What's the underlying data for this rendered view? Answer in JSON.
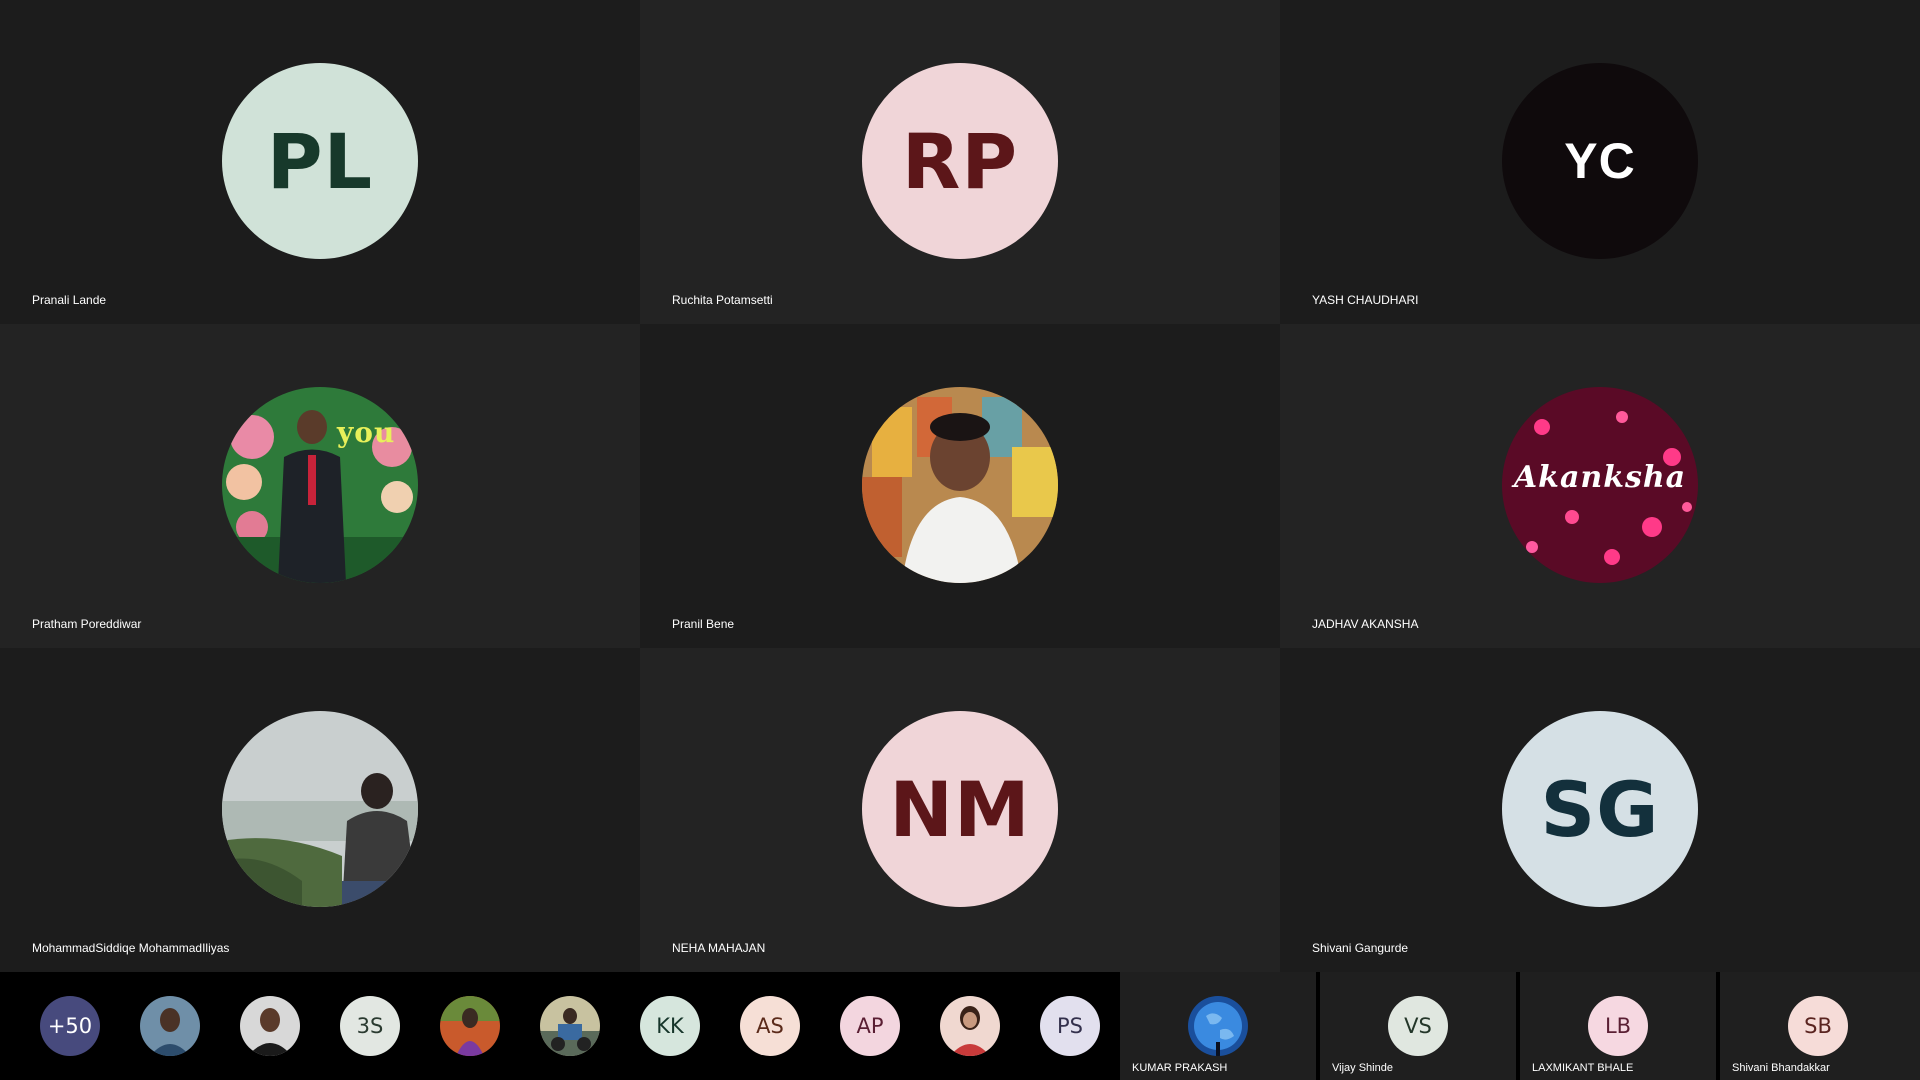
{
  "tiles": [
    {
      "name": "Pranali Lande",
      "initials": "PL",
      "bg": "#d0e2d8",
      "fg": "#17392b"
    },
    {
      "name": "Ruchita Potamsetti",
      "initials": "RP",
      "bg": "#f0d5d8",
      "fg": "#5c1619"
    },
    {
      "name": "YASH CHAUDHARI",
      "initials": "YC",
      "bg": "#0f0a0c",
      "fg": "#ffffff"
    },
    {
      "name": "Pratham Poreddiwar",
      "initials": "",
      "photo": "person-photo"
    },
    {
      "name": "Pranil Bene",
      "initials": "",
      "photo": "person-photo"
    },
    {
      "name": "JADHAV AKANSHA",
      "initials": "",
      "photo": "text-photo",
      "photo_text": "Akanksha"
    },
    {
      "name": "MohammadSiddiqe MohammadIliyas",
      "initials": "",
      "photo": "landscape-photo"
    },
    {
      "name": "NEHA MAHAJAN",
      "initials": "NM",
      "bg": "#f0d5d8",
      "fg": "#5c1619"
    },
    {
      "name": "Shivani Gangurde",
      "initials": "SG",
      "bg": "#d5e0e5",
      "fg": "#13303c"
    }
  ],
  "strip": {
    "overflow_count": "+50",
    "bubbles": [
      {
        "initials": "",
        "photo": true
      },
      {
        "initials": "",
        "photo": true
      },
      {
        "initials": "3S",
        "bg": "#e2e7e2",
        "fg": "#2a3a30"
      },
      {
        "initials": "",
        "photo": true
      },
      {
        "initials": "",
        "photo": true
      },
      {
        "initials": "KK",
        "bg": "#d6e6dd",
        "fg": "#16352a"
      },
      {
        "initials": "AS",
        "bg": "#f6dfd6",
        "fg": "#5b2a1a"
      },
      {
        "initials": "AP",
        "bg": "#f3d6df",
        "fg": "#5a1e33"
      },
      {
        "initials": "",
        "photo": true
      },
      {
        "initials": "PS",
        "bg": "#e2e0ee",
        "fg": "#33304c"
      }
    ],
    "named": [
      {
        "name": "KUMAR PRAKASH",
        "initials": "",
        "photo": true
      },
      {
        "name": "Vijay Shinde",
        "initials": "VS",
        "bg": "#e0e7e0",
        "fg": "#233629"
      },
      {
        "name": "LAXMIKANT BHALE",
        "initials": "LB",
        "bg": "#f6d8e1",
        "fg": "#5a1f33"
      },
      {
        "name": "Shivani Bhandakkar",
        "initials": "SB",
        "bg": "#f6dcd8",
        "fg": "#5a2420"
      }
    ]
  },
  "colors": {
    "tile_bg_a": "#1c1c1c",
    "tile_bg_b": "#232323",
    "strip_bg": "#000000",
    "overflow_bg": "#474a7d"
  }
}
